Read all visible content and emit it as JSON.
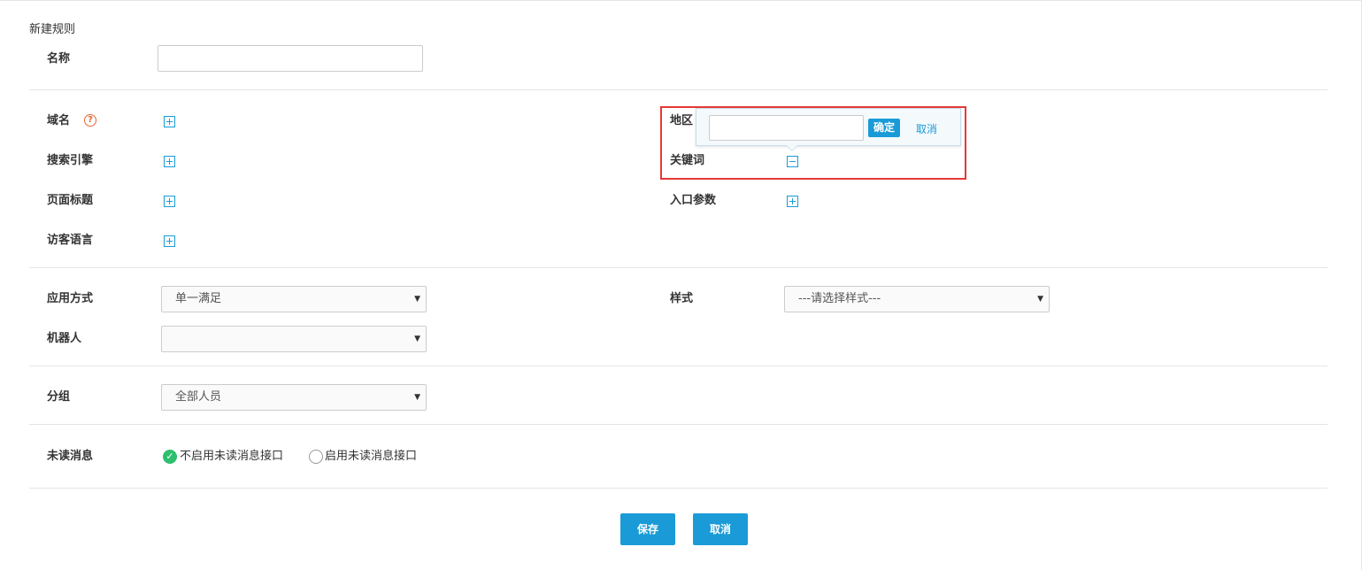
{
  "form": {
    "heading": "新建规则",
    "name_label": "名称",
    "name_value": "",
    "domain_label": "域名",
    "help_icon_text": "?",
    "search_engine_label": "搜索引擎",
    "page_title_label": "页面标题",
    "visitor_language_label": "访客语言",
    "region_label": "地区",
    "keyword_label": "关键词",
    "entry_param_label": "入口参数",
    "apply_mode_label": "应用方式",
    "apply_mode_value": "单一满足",
    "robot_label": "机器人",
    "robot_value": "",
    "style_label": "样式",
    "style_value": "---请选择样式---",
    "group_label": "分组",
    "group_value": "全部人员",
    "unread_label": "未读消息",
    "unread_options": [
      "不启用未读消息接口",
      "启用未读消息接口"
    ],
    "unread_selected": 0
  },
  "popover": {
    "input_value": "",
    "confirm_label": "确定",
    "cancel_label": "取消"
  },
  "footer": {
    "save_label": "保存",
    "cancel_label": "取消"
  },
  "colors": {
    "accent": "#1a9bd7",
    "highlight_border": "#e53935",
    "radio_checked": "#2dbf6d",
    "help_icon": "#e8662f"
  }
}
